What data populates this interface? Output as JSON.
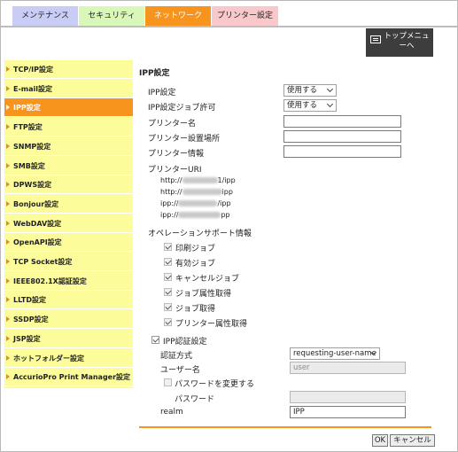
{
  "tabs": {
    "maintenance": "メンテナンス",
    "security": "セキュリティ",
    "network": "ネットワーク",
    "printer_settings": "プリンター設定"
  },
  "top_menu": {
    "label_line1": "トップメニュ",
    "label_line2": "ー",
    "label_line3": "へ",
    "icon": "menu-window-icon"
  },
  "sidebar": {
    "items": [
      {
        "label": "TCP/IP設定"
      },
      {
        "label": "E-mail設定"
      },
      {
        "label": "IPP設定"
      },
      {
        "label": "FTP設定"
      },
      {
        "label": "SNMP設定"
      },
      {
        "label": "SMB設定"
      },
      {
        "label": "DPWS設定"
      },
      {
        "label": "Bonjour設定"
      },
      {
        "label": "WebDAV設定"
      },
      {
        "label": "OpenAPI設定"
      },
      {
        "label": "TCP Socket設定"
      },
      {
        "label": "IEEE802.1X認証設定"
      },
      {
        "label": "LLTD設定"
      },
      {
        "label": "SSDP設定"
      },
      {
        "label": "JSP設定"
      },
      {
        "label": "ホットフォルダー設定"
      },
      {
        "label": "AccurioPro Print Manager設定"
      }
    ],
    "active_index": 2
  },
  "main": {
    "title": "IPP設定",
    "ipp_setting": {
      "label": "IPP設定",
      "value": "使用する"
    },
    "ipp_job_permit": {
      "label": "IPP設定ジョブ許可",
      "value": "使用する"
    },
    "printer_name": {
      "label": "プリンター名",
      "value": ""
    },
    "printer_location": {
      "label": "プリンター設置場所",
      "value": ""
    },
    "printer_info": {
      "label": "プリンター情報",
      "value": ""
    },
    "printer_uri": {
      "label": "プリンターURI",
      "lines": [
        {
          "prefix": "http://",
          "suffix": "1/ipp"
        },
        {
          "prefix": "http://",
          "suffix": "ipp"
        },
        {
          "prefix": "ipp://",
          "suffix": "/ipp"
        },
        {
          "prefix": "ipp://",
          "suffix": "pp"
        }
      ]
    },
    "operations": {
      "label": "オペレーションサポート情報",
      "items": [
        {
          "label": "印刷ジョブ",
          "checked": true
        },
        {
          "label": "有効ジョブ",
          "checked": true
        },
        {
          "label": "キャンセルジョブ",
          "checked": true
        },
        {
          "label": "ジョブ属性取得",
          "checked": true
        },
        {
          "label": "ジョブ取得",
          "checked": true
        },
        {
          "label": "プリンター属性取得",
          "checked": true
        }
      ]
    },
    "ipp_auth": {
      "label": "IPP認証設定",
      "checked": true
    },
    "auth_method": {
      "label": "認証方式",
      "value": "requesting-user-name"
    },
    "user_name": {
      "label": "ユーザー名",
      "value": "user"
    },
    "change_password": {
      "label": "パスワードを変更する",
      "checked": false
    },
    "password": {
      "label": "パスワード",
      "value": ""
    },
    "realm": {
      "label": "realm",
      "value": "IPP"
    },
    "ok_button": "OK",
    "cancel_button": "キャンセル"
  }
}
